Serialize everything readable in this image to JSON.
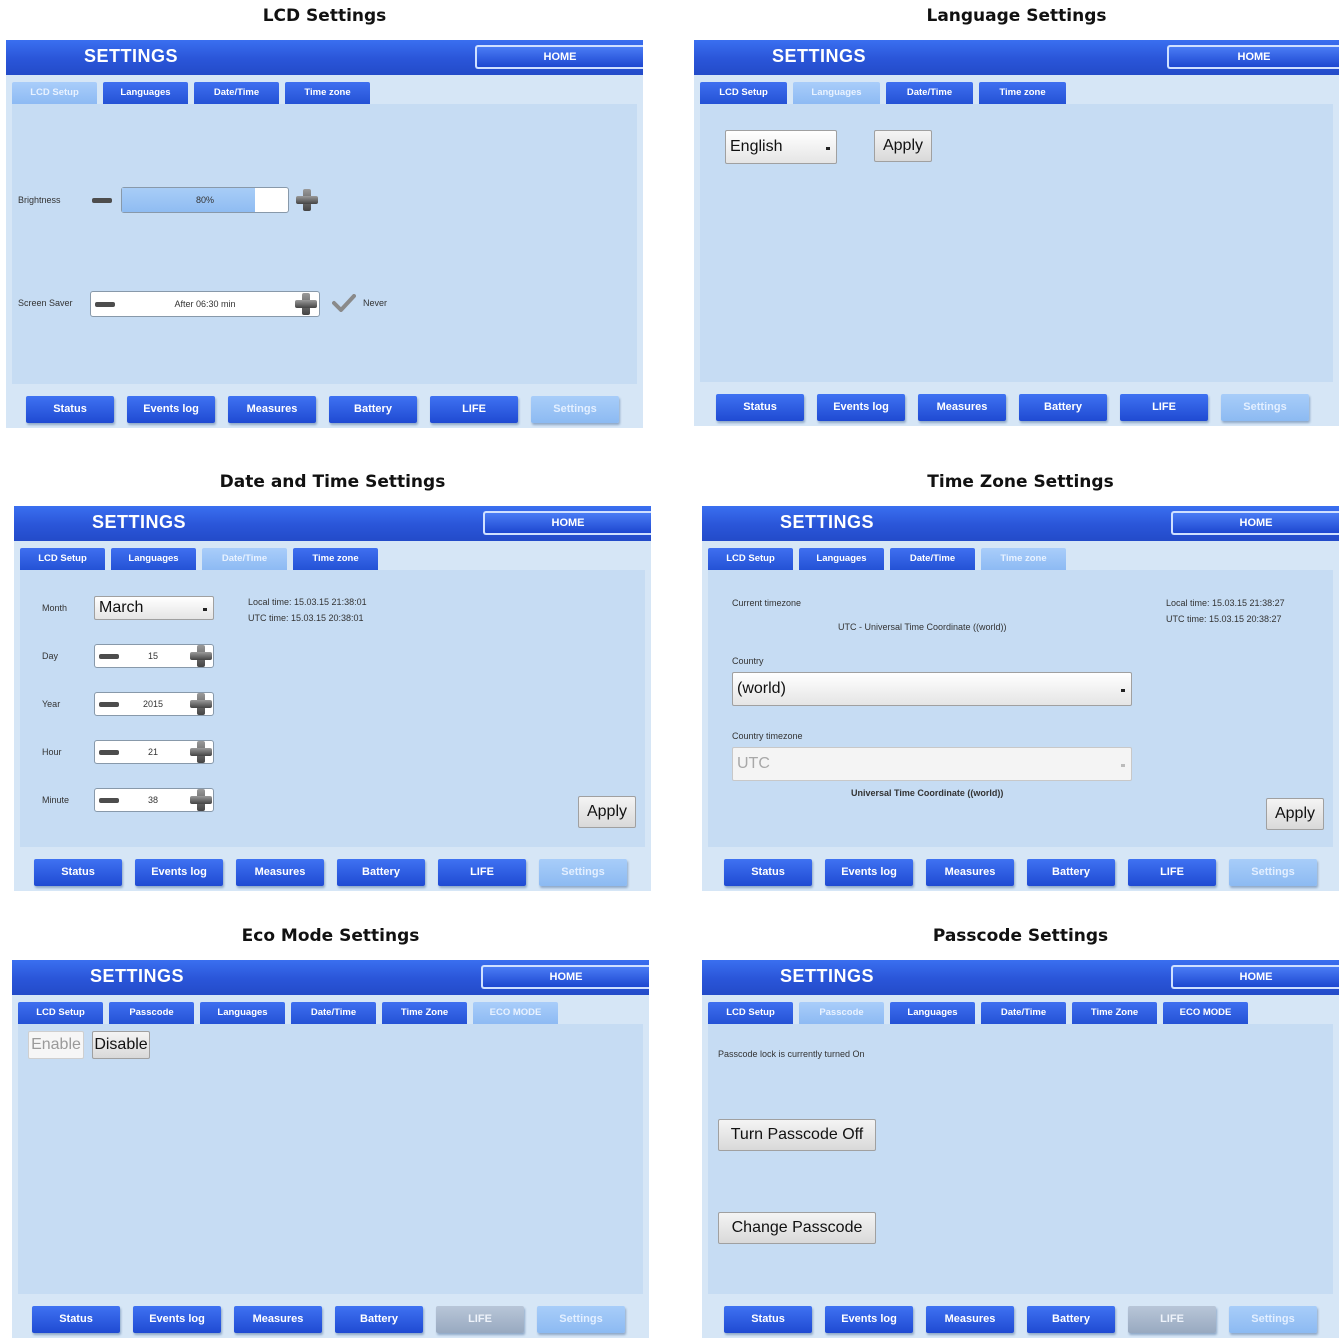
{
  "header": {
    "title": "SETTINGS",
    "home_label": "HOME"
  },
  "nav": {
    "status": "Status",
    "events_log": "Events log",
    "measures": "Measures",
    "battery": "Battery",
    "life": "LIFE",
    "settings": "Settings"
  },
  "lcd": {
    "caption": "LCD Settings",
    "tabs": [
      "LCD Setup",
      "Languages",
      "Date/Time",
      "Time zone"
    ],
    "brightness_label": "Brightness",
    "brightness_value": "80%",
    "brightness_level_percent": 80,
    "screen_saver_label": "Screen Saver",
    "screen_saver_value": "After 06:30 min",
    "never_label": "Never"
  },
  "language": {
    "caption": "Language Settings",
    "tabs": [
      "LCD Setup",
      "Languages",
      "Date/Time",
      "Time zone"
    ],
    "selected_language": "English",
    "apply_label": "Apply"
  },
  "datetime": {
    "caption": "Date and Time Settings",
    "tabs": [
      "LCD Setup",
      "Languages",
      "Date/Time",
      "Time zone"
    ],
    "month_label": "Month",
    "month_value": "March",
    "day_label": "Day",
    "day_value": "15",
    "year_label": "Year",
    "year_value": "2015",
    "hour_label": "Hour",
    "hour_value": "21",
    "minute_label": "Minute",
    "minute_value": "38",
    "local_time": "Local time: 15.03.15 21:38:01",
    "utc_time": "UTC time: 15.03.15 20:38:01",
    "apply_label": "Apply"
  },
  "timezone": {
    "caption": "Time Zone Settings",
    "tabs": [
      "LCD Setup",
      "Languages",
      "Date/Time",
      "Time zone"
    ],
    "current_label": "Current timezone",
    "current_value": "UTC - Universal Time Coordinate ((world))",
    "country_label": "Country",
    "country_value": "(world)",
    "country_tz_label": "Country timezone",
    "country_tz_value": "UTC",
    "country_tz_desc": "Universal Time Coordinate ((world))",
    "local_time": "Local time: 15.03.15 21:38:27",
    "utc_time": "UTC time: 15.03.15 20:38:27",
    "apply_label": "Apply"
  },
  "eco": {
    "caption": "Eco Mode Settings",
    "tabs": [
      "LCD Setup",
      "Passcode",
      "Languages",
      "Date/Time",
      "Time Zone",
      "ECO MODE"
    ],
    "enable_label": "Enable",
    "disable_label": "Disable"
  },
  "passcode": {
    "caption": "Passcode Settings",
    "tabs": [
      "LCD Setup",
      "Passcode",
      "Languages",
      "Date/Time",
      "Time Zone",
      "ECO MODE"
    ],
    "status_text": "Passcode lock is currently turned On",
    "turn_off_label": "Turn Passcode Off",
    "change_label": "Change Passcode"
  },
  "colors": {
    "header_blue": "#2a55d8",
    "panel_bg": "#c6dcf3",
    "active_tab": "#a9cdfa"
  }
}
